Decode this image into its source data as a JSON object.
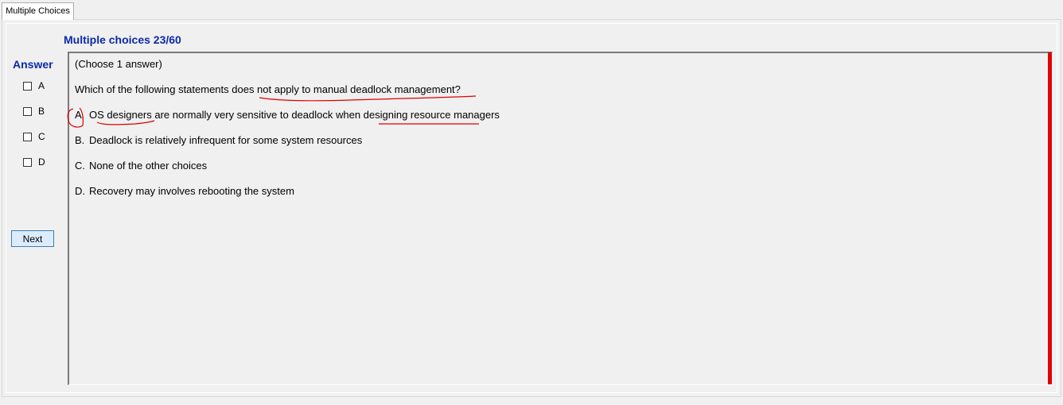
{
  "tab": {
    "label": "Multiple Choices"
  },
  "heading": "Multiple choices 23/60",
  "answer_panel": {
    "title": "Answer",
    "options": [
      {
        "label": "A",
        "checked": false
      },
      {
        "label": "B",
        "checked": false
      },
      {
        "label": "C",
        "checked": false
      },
      {
        "label": "D",
        "checked": false
      }
    ],
    "next_label": "Next"
  },
  "question": {
    "instruction": "(Choose 1 answer)",
    "text": "Which of the following statements does not apply to manual deadlock management?",
    "choices": [
      {
        "letter": "A.",
        "text": "OS designers are normally very sensitive to deadlock when designing resource managers"
      },
      {
        "letter": "B.",
        "text": "Deadlock is relatively infrequent for some system resources"
      },
      {
        "letter": "C.",
        "text": "None of the other choices"
      },
      {
        "letter": "D.",
        "text": "Recovery may involves rebooting the system"
      }
    ]
  },
  "colors": {
    "heading": "#0b2aa8",
    "annotation": "#e00000",
    "button_bg": "#dcecfc",
    "button_border": "#3c7fb1"
  }
}
